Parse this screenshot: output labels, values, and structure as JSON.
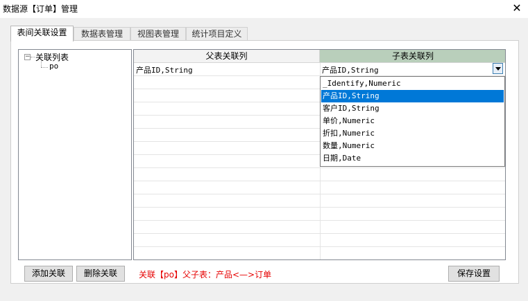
{
  "window": {
    "title": "数据源【订单】管理",
    "close_glyph": "✕"
  },
  "tabs": [
    {
      "label": "表间关联设置"
    },
    {
      "label": "数据表管理"
    },
    {
      "label": "视图表管理"
    },
    {
      "label": "统计项目定义"
    }
  ],
  "tree": {
    "expander": "−",
    "root": "关联列表",
    "child": "po"
  },
  "grid": {
    "headers": {
      "parent": "父表关联列",
      "child": "子表关联列"
    },
    "row1": {
      "parent": "产品ID,String",
      "child": "产品ID,String"
    }
  },
  "dropdown": {
    "options": [
      "_Identify,Numeric",
      "产品ID,String",
      "客户ID,String",
      "单价,Numeric",
      "折扣,Numeric",
      "数量,Numeric",
      "日期,Date"
    ],
    "selected": "产品ID,String"
  },
  "buttons": {
    "add": "添加关联",
    "delete": "删除关联",
    "save": "保存设置"
  },
  "status": "关联【po】父子表：产品<—>订单",
  "colors": {
    "child_header": "#b9cfbb",
    "selection": "#0078d7",
    "status_text": "#e60000"
  }
}
